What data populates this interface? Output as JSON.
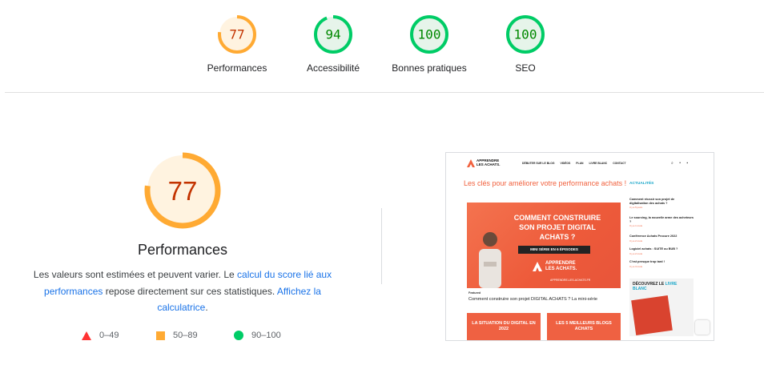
{
  "gauges": [
    {
      "score": "77",
      "label": "Performances",
      "value": 0.77,
      "color": "#fa3",
      "bg": "#fff3e0",
      "text_color": "#c33300"
    },
    {
      "score": "94",
      "label": "Accessibilité",
      "value": 0.94,
      "color": "#0c6",
      "bg": "#e6f4ea",
      "text_color": "#080"
    },
    {
      "score": "100",
      "label": "Bonnes pratiques",
      "value": 1.0,
      "color": "#0c6",
      "bg": "#e6f4ea",
      "text_color": "#080"
    },
    {
      "score": "100",
      "label": "SEO",
      "value": 1.0,
      "color": "#0c6",
      "bg": "#e6f4ea",
      "text_color": "#080"
    }
  ],
  "main": {
    "score": "77",
    "value": 0.77,
    "title": "Performances",
    "desc_before": "Les valeurs sont estimées et peuvent varier. Le ",
    "desc_link1": "calcul du score lié aux performances",
    "desc_middle": " repose directement sur ces statistiques. ",
    "desc_link2": "Affichez la calculatrice",
    "desc_end": "."
  },
  "legend": [
    {
      "label": "0–49",
      "shape": "triangle",
      "color": "#f33"
    },
    {
      "label": "50–89",
      "shape": "square",
      "color": "#fa3"
    },
    {
      "label": "90–100",
      "shape": "circle",
      "color": "#0c6"
    }
  ],
  "screenshot": {
    "logo_line1": "APPRENDRE",
    "logo_line2": "LES ACHATS.",
    "nav": [
      "DÉBUTER SUR LE BLOG",
      "VIDÉOS",
      "PLAN",
      "LIVRE BLANC",
      "CONTACT"
    ],
    "headline": "Les clés pour améliorer votre performance achats !",
    "hero_title": "COMMENT CONSTRUIRE SON PROJET DIGITAL ACHATS ?",
    "hero_pill": "MINI SÉRIE EN 6 ÉPISODES",
    "hero_brand_line1": "APPRENDRE",
    "hero_brand_line2": "LES ACHATS.",
    "hero_site": "APPRENDRE-LES-ACHATS.FR",
    "caption_small": "Featured",
    "caption": "Comment construire son projet DIGITAL ACHATS ? La mini-série",
    "card1": "LA SITUATION DU DIGITAL EN 2022",
    "card2": "LES 5 MEILLEURS BLOGS ACHATS",
    "sidebar_title": "ACTUALITÉS",
    "news": [
      {
        "title": "Comment réussir son projet de digitalisation des achats ?",
        "date": "Il y a 5 jours"
      },
      {
        "title": "Le sourcing, la nouvelle arme des acheteurs ?",
        "date": "Il y a 1 mois"
      },
      {
        "title": "Conférence Achats Procure 2022",
        "date": "Il y a 2 mois"
      },
      {
        "title": "Logiciel achats : SUITE ou BUB ?",
        "date": "Il y a 2 mois"
      },
      {
        "title": "C'est presque trop tard !",
        "date": "Il y a 3 mois"
      }
    ],
    "promo_line1": "DÉCOUVREZ LE",
    "promo_accent": "LIVRE",
    "promo_line2": "BLANC"
  }
}
